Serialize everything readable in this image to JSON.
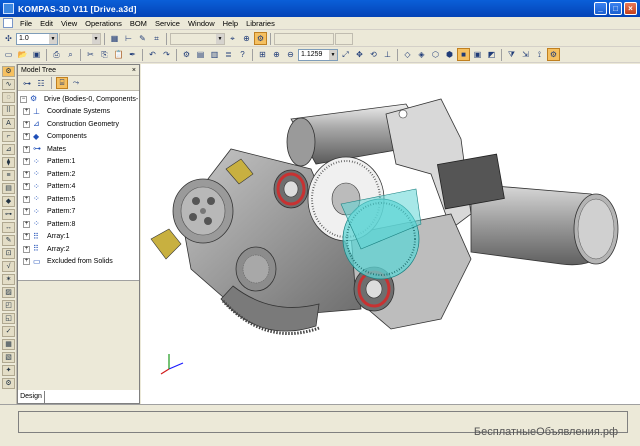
{
  "window": {
    "title": "KOMPAS-3D V11   [Drive.a3d]"
  },
  "menu": [
    "File",
    "Edit",
    "View",
    "Operations",
    "BOM",
    "Service",
    "Window",
    "Help",
    "Libraries"
  ],
  "toolbar1": {
    "scale_value": "1.0"
  },
  "toolbar2": {
    "zoom_value": "1.1259"
  },
  "tree": {
    "header": "Model Tree",
    "items": [
      {
        "label": "Drive (Bodies-0, Components-",
        "icon": "assembly-icon"
      },
      {
        "label": "Coordinate Systems",
        "icon": "coordinate-system-icon"
      },
      {
        "label": "Construction Geometry",
        "icon": "construction-geometry-icon"
      },
      {
        "label": "Components",
        "icon": "components-icon"
      },
      {
        "label": "Mates",
        "icon": "mates-icon"
      },
      {
        "label": "Pattern:1",
        "icon": "pattern-icon"
      },
      {
        "label": "Pattern:2",
        "icon": "pattern-icon"
      },
      {
        "label": "Pattern:4",
        "icon": "pattern-icon"
      },
      {
        "label": "Pattern:5",
        "icon": "pattern-icon"
      },
      {
        "label": "Pattern:7",
        "icon": "pattern-icon"
      },
      {
        "label": "Pattern:8",
        "icon": "pattern-icon"
      },
      {
        "label": "Array:1",
        "icon": "array-icon"
      },
      {
        "label": "Array:2",
        "icon": "array-icon"
      },
      {
        "label": "Excluded from Solids",
        "icon": "excluded-icon"
      }
    ],
    "tab": "Design"
  },
  "watermark": "БесплатныеОбъявления.рф",
  "colors": {
    "titlebar": "#0a5fd8",
    "model_gray": "#8c8c8c",
    "accent_cyan": "#5fd6d6",
    "dial_red": "#c83232"
  }
}
